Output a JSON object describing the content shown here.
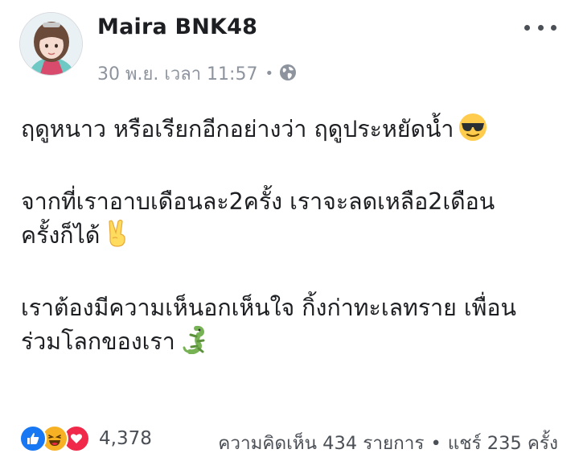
{
  "post": {
    "author": "Maira BNK48",
    "date": "30 พ.ย. เวลา 11:57",
    "separator": "•",
    "paragraphs": [
      [
        "ฤดูหนาว หรือเรียกอีกอย่างว่า ฤดูประหยัดน้ำ"
      ],
      [
        "จากที่เราอาบเดือนละ2ครั้ง เราจะลดเหลือ2เดือน",
        "ครั้งก็ได้"
      ],
      [
        "เราต้องมีความเห็นอกเห็นใจ กิ้งก่าทะเลทราย เพื่อน",
        "ร่วมโลกของเรา"
      ]
    ],
    "p1_line1": "ฤดูหนาว หรือเรียกอีกอย่างว่า ฤดูประหยัดน้ำ",
    "p2_line1": "จากที่เราอาบเดือนละ2ครั้ง เราจะลดเหลือ2เดือน",
    "p2_line2": "ครั้งก็ได้",
    "p3_line1": "เราต้องมีความเห็นอกเห็นใจ กิ้งก่าทะเลทราย เพื่อน",
    "p3_line2": "ร่วมโลกของเรา",
    "emojis": [
      "smiling-face-with-sunglasses",
      "victory-hand",
      "lizard"
    ]
  },
  "footer": {
    "reaction_count": "4,378",
    "comments": "ความคิดเห็น 434 รายการ",
    "separator": "•",
    "shares": "แชร์ 235 ครั้ง"
  },
  "colors": {
    "like": "#1877f2",
    "haha": "#f7b125",
    "love": "#f0284a",
    "meta": "#8d949e"
  }
}
